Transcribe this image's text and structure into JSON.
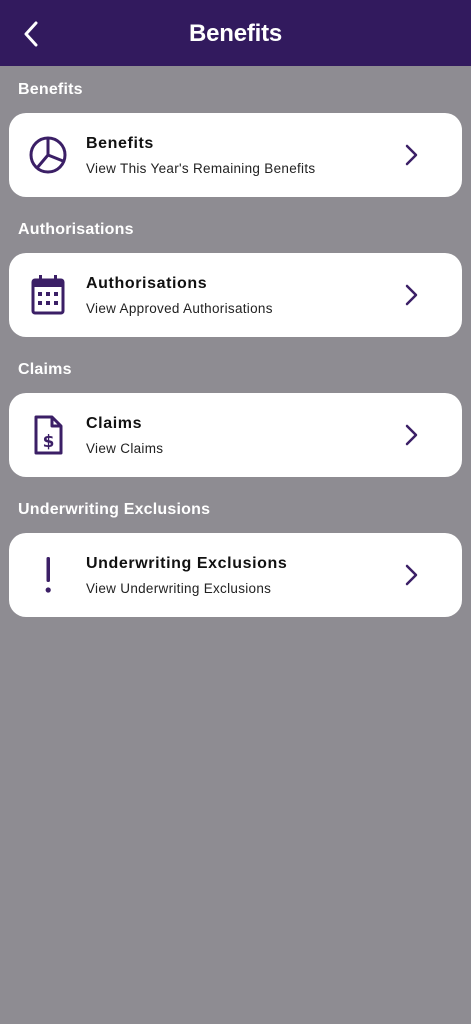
{
  "header": {
    "title": "Benefits",
    "back_icon": "chevron-left-icon"
  },
  "colors": {
    "header_bg": "#321a5e",
    "page_bg": "#8e8c92",
    "accent": "#3b1f66",
    "card_bg": "#ffffff"
  },
  "sections": [
    {
      "label": "Benefits",
      "card": {
        "title": "Benefits",
        "subtitle": "View This Year's Remaining Benefits",
        "icon": "pie-chart-icon"
      }
    },
    {
      "label": "Authorisations",
      "card": {
        "title": "Authorisations",
        "subtitle": "View Approved Authorisations",
        "icon": "calendar-icon"
      }
    },
    {
      "label": "Claims",
      "card": {
        "title": "Claims",
        "subtitle": "View Claims",
        "icon": "dollar-document-icon"
      }
    },
    {
      "label": "Underwriting Exclusions",
      "card": {
        "title": "Underwriting Exclusions",
        "subtitle": "View Underwriting Exclusions",
        "icon": "exclamation-icon"
      }
    }
  ]
}
